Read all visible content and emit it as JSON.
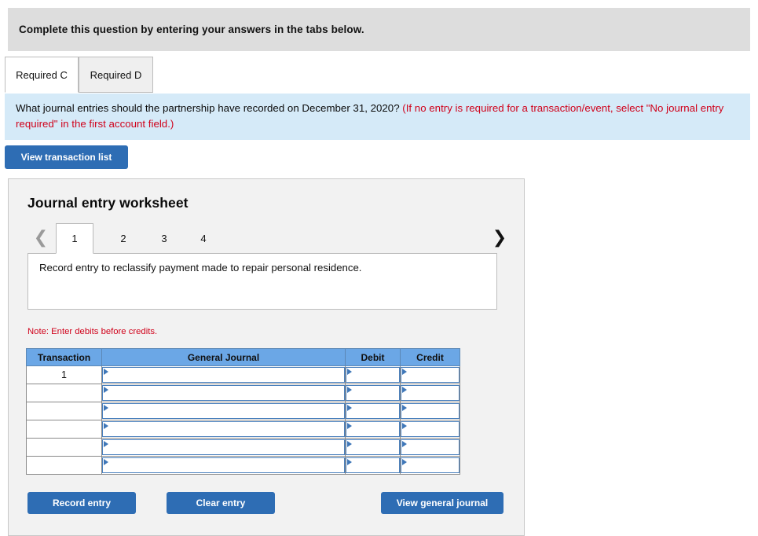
{
  "banner": {
    "instruction": "Complete this question by entering your answers in the tabs below."
  },
  "tabs": [
    {
      "label": "Required C",
      "active": true
    },
    {
      "label": "Required D",
      "active": false
    }
  ],
  "question": {
    "prompt": "What journal entries should the partnership have recorded on December 31, 2020? ",
    "hint": "(If no entry is required for a transaction/event, select \"No journal entry required\" in the first account field.)"
  },
  "actions": {
    "view_transaction_list": "View transaction list",
    "record_entry": "Record entry",
    "clear_entry": "Clear entry",
    "view_general_journal": "View general journal"
  },
  "worksheet": {
    "title": "Journal entry worksheet",
    "pager": {
      "prev_icon": "chevron-left",
      "next_icon": "chevron-right",
      "pages": [
        "1",
        "2",
        "3",
        "4"
      ],
      "active_page": "1"
    },
    "description": "Record entry to reclassify payment made to repair personal residence.",
    "note": "Note: Enter debits before credits.",
    "table": {
      "headers": [
        "Transaction",
        "General Journal",
        "Debit",
        "Credit"
      ],
      "rows": [
        {
          "transaction": "1",
          "general_journal": "",
          "debit": "",
          "credit": ""
        },
        {
          "transaction": "",
          "general_journal": "",
          "debit": "",
          "credit": ""
        },
        {
          "transaction": "",
          "general_journal": "",
          "debit": "",
          "credit": ""
        },
        {
          "transaction": "",
          "general_journal": "",
          "debit": "",
          "credit": ""
        },
        {
          "transaction": "",
          "general_journal": "",
          "debit": "",
          "credit": ""
        },
        {
          "transaction": "",
          "general_journal": "",
          "debit": "",
          "credit": ""
        }
      ]
    }
  },
  "colors": {
    "banner_gray": "#dddddd",
    "question_blue": "#d5eaf8",
    "button_blue": "#2e6db4",
    "table_header_blue": "#6ba7e6",
    "note_red": "#d0021b",
    "panel_gray": "#f2f2f2"
  }
}
